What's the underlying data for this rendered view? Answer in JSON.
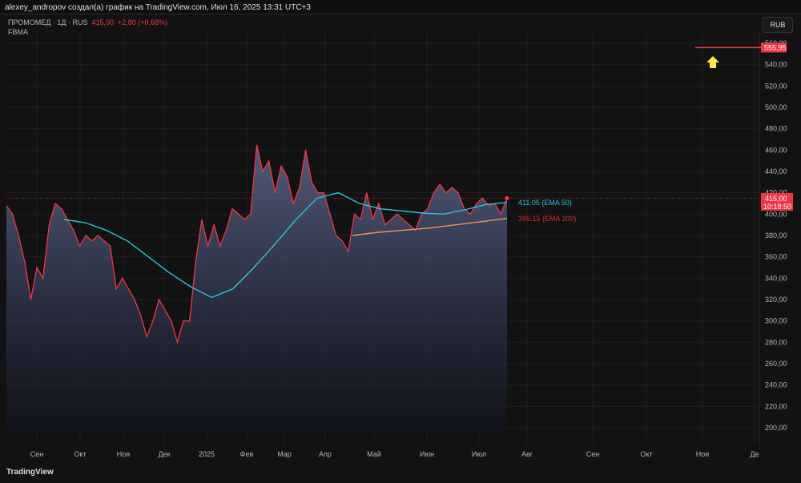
{
  "header": {
    "caption": "alexey_andropov создал(а) график на TradingView.com, Июл 16, 2025 13:31 UTC+3"
  },
  "legend": {
    "symbol": "ПРОМОМЕД · 1Д · RUS",
    "price": "415,00",
    "change": "+2,80 (+0,68%)",
    "indicator": "FBMA"
  },
  "currency_button": "RUB",
  "logo": "TradingView",
  "chart_data": {
    "type": "area",
    "ylim": [
      190,
      570
    ],
    "y_ticks": [
      "560,00",
      "540,00",
      "520,00",
      "500,00",
      "480,00",
      "460,00",
      "440,00",
      "420,00",
      "400,00",
      "380,00",
      "360,00",
      "340,00",
      "320,00",
      "300,00",
      "280,00",
      "260,00",
      "240,00",
      "220,00",
      "200,00"
    ],
    "y_tick_values": [
      560,
      540,
      520,
      500,
      480,
      460,
      440,
      420,
      400,
      380,
      360,
      340,
      320,
      300,
      280,
      260,
      240,
      220,
      200
    ],
    "x_ticks": [
      "Сен",
      "Окт",
      "Ноя",
      "Дек",
      "2025",
      "Фев",
      "Мар",
      "Апр",
      "Май",
      "Июн",
      "Июл",
      "Авг",
      "Сен",
      "Окт",
      "Ноя",
      "Де"
    ],
    "price": [
      408,
      400,
      380,
      355,
      320,
      350,
      340,
      390,
      410,
      405,
      395,
      385,
      370,
      380,
      375,
      380,
      375,
      370,
      330,
      340,
      330,
      320,
      305,
      285,
      300,
      320,
      310,
      300,
      280,
      300,
      300,
      355,
      395,
      370,
      390,
      370,
      385,
      405,
      400,
      395,
      400,
      465,
      440,
      450,
      420,
      445,
      435,
      410,
      425,
      460,
      430,
      420,
      420,
      400,
      380,
      375,
      365,
      400,
      395,
      420,
      395,
      410,
      390,
      395,
      400,
      395,
      390,
      385,
      400,
      405,
      420,
      428,
      420,
      425,
      420,
      405,
      400,
      410,
      415,
      408,
      410,
      400,
      415
    ],
    "ema50": [
      395,
      392,
      385,
      375,
      360,
      345,
      332,
      322,
      330,
      350,
      372,
      395,
      415,
      420,
      410,
      405,
      403,
      401,
      400,
      404,
      409,
      411
    ],
    "ema200": [
      380,
      383,
      385,
      387,
      390,
      393,
      396
    ],
    "ema50_label": "411.05 (EMA 50)",
    "ema200_label": "396.15 (EMA 200)",
    "last_price_label": "415,00",
    "countdown": "10:18:50",
    "target_line_value": 555.95,
    "target_label": "555,95",
    "colors": {
      "price": "#f23645",
      "ema50": "#26c6da",
      "ema200": "#f0945a",
      "arrow": "#ffeb3b"
    }
  }
}
